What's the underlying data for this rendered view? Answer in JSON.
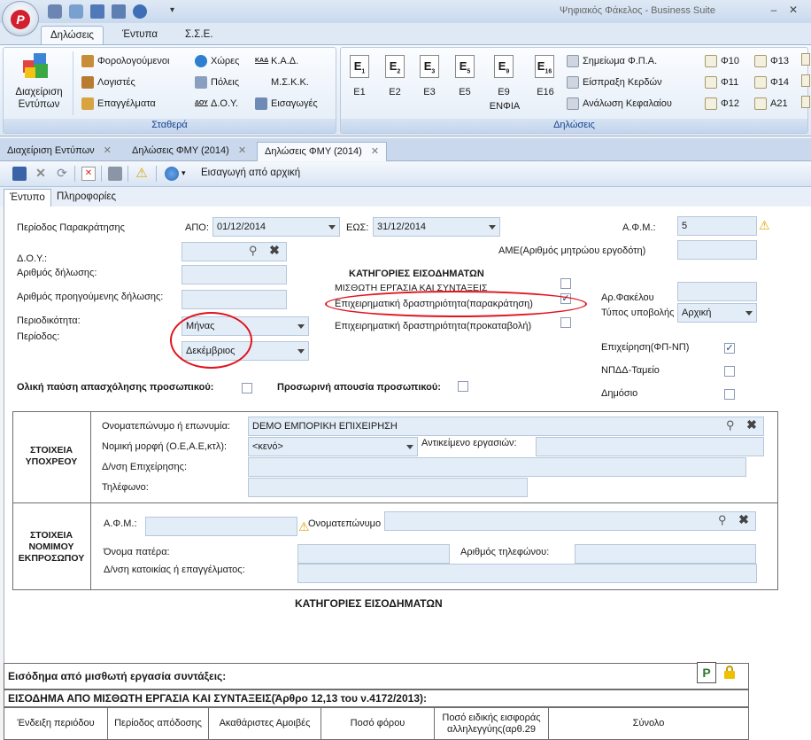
{
  "window": {
    "title": "Ψηφιακός Φάκελος - Business Suite"
  },
  "ribbon": {
    "tabs": [
      "Δηλώσεις",
      "Έντυπα",
      "Σ.Σ.Ε."
    ],
    "groups": {
      "stathera": {
        "label": "Σταθερά",
        "manage_line1": "Διαχείριση",
        "manage_line2": "Εντύπων",
        "col1": [
          "Φορολογούμενοι",
          "Λογιστές",
          "Επαγγέλματα"
        ],
        "col2": [
          "Χώρες",
          "Πόλεις",
          "Δ.Ο.Υ."
        ],
        "col3": [
          "Κ.Α.Δ.",
          "Μ.Σ.Κ.Κ.",
          "Εισαγωγές"
        ],
        "doy_icon_text": "ΔΟΥ",
        "kad_icon_text": "ΚΑΔ"
      },
      "dilwseis": {
        "label": "Δηλώσεις",
        "forms": [
          "Ε1",
          "Ε2",
          "Ε3",
          "Ε5",
          "Ε9",
          "Ε16"
        ],
        "enfia": "ΕΝΦΙΑ",
        "col_reports": [
          "Σημείωμα Φ.Π.Α.",
          "Είσπραξη Κερδών",
          "Ανάλωση Κεφαλαίου"
        ],
        "col_f1": [
          "Φ10",
          "Φ11",
          "Φ12"
        ],
        "col_f2": [
          "Φ13",
          "Φ14",
          "Α21"
        ]
      }
    }
  },
  "doc_tabs": [
    "Διαχείριση Εντύπων",
    "Δηλώσεις ΦΜΥ (2014)",
    "Δηλώσεις ΦΜΥ (2014)"
  ],
  "toolbar": {
    "import_label": "Εισαγωγή από αρχική"
  },
  "inner_tabs": [
    "Έντυπο",
    "Πληροφορίες"
  ],
  "form": {
    "period_label": "Περίοδος Παρακράτησης",
    "from_label": "ΑΠΟ:",
    "from_value": "01/12/2014",
    "to_label": "ΕΩΣ:",
    "to_value": "31/12/2014",
    "afm_label": "Α.Φ.Μ.:",
    "afm_value": "5",
    "doy_label": "Δ.Ο.Υ.:",
    "decl_no_label": "Αριθμός δήλωσης:",
    "prev_decl_label": "Αριθμός προηγούμενης δήλωσης:",
    "periodicity_label": "Περιοδικότητα:",
    "periodicity_value": "Μήνας",
    "period2_label": "Περίοδος:",
    "period2_value": "Δεκέμβριος",
    "ame_label": "ΑΜΕ(Αριθμός μητρώου εργοδότη)",
    "categories_title": "ΚΑΤΗΓΟΡΙΕΣ ΕΙΣΟΔΗΜΑΤΩΝ",
    "cat1": "ΜΙΣΘΩΤΗ ΕΡΓΑΣΙΑ ΚΑΙ ΣΥΝΤΑΞΕΙΣ",
    "cat2": "Επιχειρηματική δραστηριότητα(παρακράτηση)",
    "cat3": "Επιχειρηματική δραστηριότητα(προκαταβολή)",
    "folder_label": "Αρ.Φακέλου",
    "submit_type_label": "Τύπος υποβολής",
    "submit_type_value": "Αρχική",
    "business_label": "Επιχείρηση(ΦΠ-ΝΠ)",
    "npdd_label": "ΝΠΔΔ-Ταμείο",
    "public_label": "Δημόσιο",
    "total_stop_label": "Ολική παύση απασχόλησης προσωπικού:",
    "temp_absence_label": "Προσωρινή απουσία προσωπικού:"
  },
  "obligor": {
    "section_title_1": "ΣΤΟΙΧΕΙΑ",
    "section_title_2": "ΥΠΟΧΡΕΟΥ",
    "name_label": "Ονοματεπώνυμο ή επωνυμία:",
    "name_value": "DEMO ΕΜΠΟΡΙΚΗ ΕΠΙΧΕΙΡΗΣΗ",
    "legal_form_label": "Νομική μορφή (Ο.Ε,Α.Ε,κτλ):",
    "legal_form_value": "<κενό>",
    "business_object_label": "Αντικείμενο εργασιών:",
    "address_label": "Δ/νση Επιχείρησης:",
    "phone_label": "Τηλέφωνο:"
  },
  "representative": {
    "section_title_1": "ΣΤΟΙΧΕΙΑ",
    "section_title_2": "ΝΟΜΙΜΟΥ",
    "section_title_3": "ΕΚΠΡΟΣΩΠΟΥ",
    "afm_label": "Α.Φ.Μ.:",
    "name_label": "Ονοματεπώνυμο",
    "father_label": "Όνομα πατέρα:",
    "phone_label": "Αριθμός τηλεφώνου:",
    "address_label": "Δ/νση κατοικίας ή επαγγέλματος:"
  },
  "income": {
    "title": "ΚΑΤΗΓΟΡΙΕΣ ΕΙΣΟΔΗΜΑΤΩΝ",
    "section_heading": "Εισόδημα από μισθωτή εργασία συντάξεις:",
    "table_title": "ΕΙΣΟΔΗΜΑ ΑΠΟ ΜΙΣΘΩΤΗ ΕΡΓΑΣΙΑ ΚΑΙ ΣΥΝΤΑΞΕΙΣ(Άρθρο 12,13 του ν.4172/2013):",
    "columns": [
      "Ένδειξη περιόδου",
      "Περίοδος απόδοσης",
      "Ακαθάριστες Αμοιβές",
      "Ποσό φόρου",
      "Ποσό ειδικής εισφοράς αλληλεγγύης(αρθ.29",
      "Σύνολο"
    ]
  },
  "colors": {
    "accent": "#15428b",
    "field_bg": "#e3edf8",
    "annotation_red": "#e0151e"
  }
}
